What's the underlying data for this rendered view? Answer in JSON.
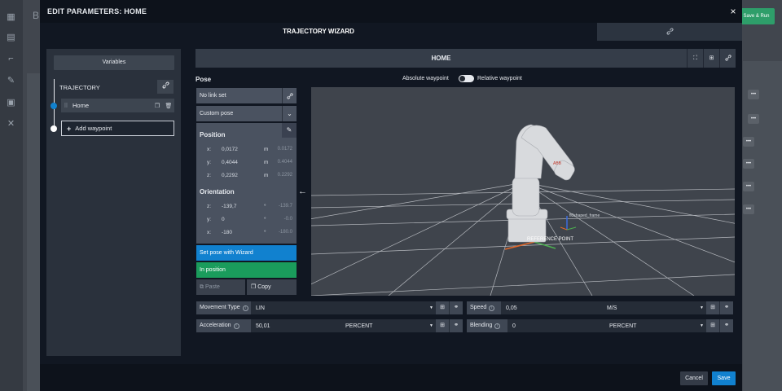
{
  "background": {
    "header_letter": "B",
    "save_and_run_label": "Save & Run",
    "menu_dots": "•••",
    "accent_green": "#2e9e6a"
  },
  "modal": {
    "title": "EDIT PARAMETERS: HOME",
    "close_glyph": "×",
    "tabs": {
      "wizard_label": "TRAJECTORY WIZARD",
      "links_icon": "link-icon"
    }
  },
  "left_panel": {
    "variables_label": "Variables",
    "trajectory_label": "TRAJECTORY",
    "waypoints": [
      {
        "label": "Home"
      }
    ],
    "add_waypoint_label": "Add waypoint"
  },
  "home_bar": {
    "title": "HOME"
  },
  "pose": {
    "heading": "Pose",
    "absolute_label": "Absolute waypoint",
    "relative_label": "Relative waypoint",
    "toggle_relative": false,
    "link_select": "No link set",
    "pose_select": "Custom pose",
    "position_heading": "Position",
    "position": [
      {
        "axis": "x:",
        "value": "0,0172",
        "unit": "m",
        "current": "0.0172"
      },
      {
        "axis": "y:",
        "value": "0,4044",
        "unit": "m",
        "current": "0.4044"
      },
      {
        "axis": "z:",
        "value": "0,2292",
        "unit": "m",
        "current": "0.2292"
      }
    ],
    "orientation_heading": "Orientation",
    "orientation": [
      {
        "axis": "z:",
        "value": "-139,7",
        "unit": "°",
        "current": "-139.7"
      },
      {
        "axis": "y:",
        "value": "0",
        "unit": "°",
        "current": "-0.0"
      },
      {
        "axis": "x:",
        "value": "-180",
        "unit": "°",
        "current": "-180.0"
      }
    ],
    "set_pose_label": "Set pose with Wizard",
    "in_position_label": "In position",
    "paste_label": "Paste",
    "copy_label": "Copy"
  },
  "viewport": {
    "frame_label": "fl0shaped_frame",
    "reference_label": "REFERENCE POINT",
    "robot_brand": "ABB"
  },
  "parameters": {
    "movement_type": {
      "label": "Movement Type",
      "value": "LIN"
    },
    "speed": {
      "label": "Speed",
      "value": "0,05",
      "unit": "M/S"
    },
    "acceleration": {
      "label": "Acceleration",
      "value": "50,01",
      "unit": "PERCENT"
    },
    "blending": {
      "label": "Blending",
      "value": "0",
      "unit": "PERCENT"
    }
  },
  "footer": {
    "cancel_label": "Cancel",
    "save_label": "Save"
  },
  "colors": {
    "primary_blue": "#1181cf",
    "success_green": "#1a9c5c",
    "modal_bg": "#111722"
  }
}
